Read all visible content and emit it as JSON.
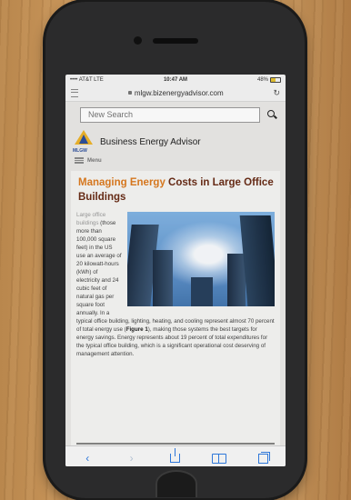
{
  "status_bar": {
    "carrier": "•••• AT&T  LTE",
    "time": "10:47 AM",
    "battery": "48%",
    "battery_level": 0.48
  },
  "browser": {
    "url": "mlgw.bizenergyadvisor.com"
  },
  "site": {
    "search_placeholder": "New Search",
    "logo_text": "MLGW",
    "brand_name": "Business Energy Advisor",
    "menu_label": "Menu"
  },
  "article": {
    "headline": "Managing Energy Costs in Large Office Buildings",
    "lead_in": "Large office buildings",
    "body_1": " (those more than 100,000 square feet) in the US use an average of 20 kilowatt-hours (kWh) of electricity and 24 cubic feet of natural gas per square foot annually. In a typical office building, lighting, heating, and cooling represent almost 70 percent of total energy use (",
    "figure_ref": "Figure 1",
    "body_2": "), making those systems the best targets for energy savings. Energy represents about 19 percent of total expenditures for the typical office building, which is a significant operational cost deserving of management attention."
  },
  "toolbar": {
    "back_icon": "back-icon",
    "forward_icon": "forward-icon",
    "share_icon": "share-icon",
    "bookmarks_icon": "bookmarks-icon",
    "tabs_icon": "tabs-icon"
  },
  "colors": {
    "headline": "#6b2b14",
    "accent": "#2c7be5",
    "logo_yellow": "#f0b323",
    "logo_blue": "#2a4ea0"
  }
}
